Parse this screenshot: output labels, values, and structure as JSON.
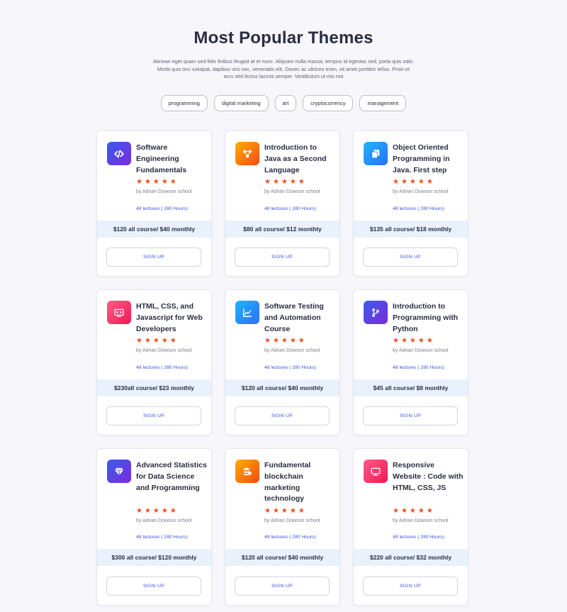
{
  "page": {
    "title": "Most Popular Themes",
    "subtitle": "Aenean eget quam sed felis finibus feugiat at et nunc. Aliquam nulla massa, tempus id egestas sed, porta quis odio. Morbi quis orci volutpat, dapibus orci nec, venenatis elit. Donec ac ultrices enim, sit amet porttitor tellus. Proin et arcu sed lectus lacinia semper. Vestibulum ut nisi nisi"
  },
  "tags": [
    "programming",
    "digital marketing",
    "art",
    "cryptocurrency",
    "management"
  ],
  "colors": {
    "accent": "#3b4ee0",
    "star": "#f04a1d",
    "price_bar": "#e9f1fd"
  },
  "courses": [
    {
      "title": "Software Engineering Fundamentals",
      "icon": "code-icon",
      "icon_gradient": [
        "#3a5cf0",
        "#7b2bd9"
      ],
      "rating_stars": 5,
      "stars": "★★★★★",
      "author": "by Adrian Dowson school",
      "lectures": "48 lectures ( 280 Hours)",
      "price": "$120 all course/ $40 monthly",
      "signup": "SIGN UP"
    },
    {
      "title": "Introduction to Java as a Second Language",
      "icon": "flow-icon",
      "icon_gradient": [
        "#ffae00",
        "#f14a1a"
      ],
      "rating_stars": 5,
      "stars": "★★★★★",
      "author": "by Adrian Dowson school",
      "lectures": "48 lectures ( 280 Hours)",
      "price": "$80 all course/ $12 monthly",
      "signup": "SIGN UP"
    },
    {
      "title": "Object Oriented Programming in Java. First step",
      "icon": "copy-icon",
      "icon_gradient": [
        "#1fb6ff",
        "#2d6ef5"
      ],
      "rating_stars": 5,
      "stars": "★★★★★",
      "author": "by Adrian Dowson school",
      "lectures": "48 lectures ( 280 Hours)",
      "price": "$135 all course/ $18 monthly",
      "signup": "SIGN UP"
    },
    {
      "title": "HTML, CSS, and Javascript for Web Developers",
      "icon": "monitor-code-icon",
      "icon_gradient": [
        "#ff5c8a",
        "#f01850"
      ],
      "rating_stars": 5,
      "stars": "★★★★★",
      "author": "by Adrian Dowson school",
      "lectures": "48 lectures ( 280 Hours)",
      "price": "$230all course/ $23 monthly",
      "signup": "SIGN UP"
    },
    {
      "title": "Software Testing and Automation Course",
      "icon": "chart-line-icon",
      "icon_gradient": [
        "#1fb6ff",
        "#2d6ef5"
      ],
      "rating_stars": 5,
      "stars": "★★★★★",
      "author": "by Adrian Dowson school",
      "lectures": "48 lectures ( 280 Hours)",
      "price": "$120 all course/ $40 monthly",
      "signup": "SIGN UP"
    },
    {
      "title": "Introduction to Programming with Python",
      "icon": "branch-icon",
      "icon_gradient": [
        "#3a5cf0",
        "#7b2bd9"
      ],
      "rating_stars": 5,
      "stars": "★★★★★",
      "author": "by Adrian Dowson school",
      "lectures": "48 lectures ( 280 Hours)",
      "price": "$45 all course/ $8 monthly",
      "signup": "SIGN UP"
    },
    {
      "title": "Advanced Statistics for Data Science and Programming",
      "icon": "diamond-icon",
      "icon_gradient": [
        "#3a5cf0",
        "#7b2bd9"
      ],
      "rating_stars": 5,
      "stars": "★★★★★",
      "author": "by Adrian Dowson school",
      "lectures": "48 lectures ( 280 Hours)",
      "price": "$300 all course/ $120 monthly",
      "signup": "SIGN UP"
    },
    {
      "title": "Fundamental blockchain marketing technology",
      "icon": "coins-icon",
      "icon_gradient": [
        "#ffae00",
        "#f14a1a"
      ],
      "rating_stars": 5,
      "stars": "★★★★★",
      "author": "by Adrian Dowson school",
      "lectures": "48 lectures ( 280 Hours)",
      "price": "$120 all course/ $40 monthly",
      "signup": "SIGN UP"
    },
    {
      "title": "Responsive Website : Code with HTML, CSS, JS",
      "icon": "monitor-icon",
      "icon_gradient": [
        "#ff5c8a",
        "#f01850"
      ],
      "rating_stars": 5,
      "stars": "★★★★★",
      "author": "by Adrian Dowson school",
      "lectures": "48 lectures ( 280 Hours)",
      "price": "$220 all course/ $32 monthly",
      "signup": "SIGN UP"
    }
  ]
}
